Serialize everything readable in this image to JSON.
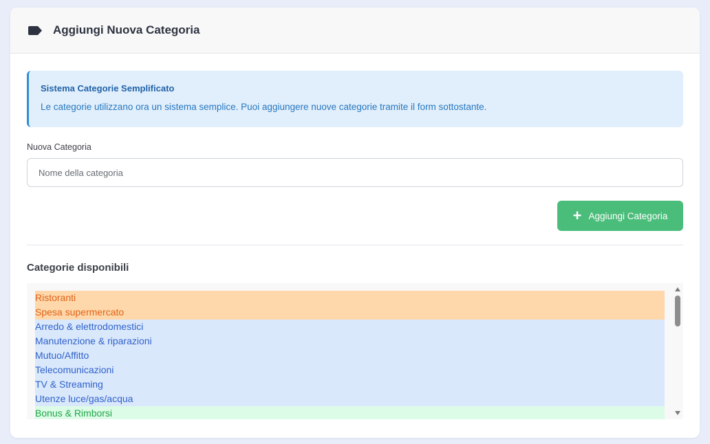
{
  "header": {
    "title": "Aggiungi Nuova Categoria",
    "icon": "tag-icon"
  },
  "info": {
    "title": "Sistema Categorie Semplificato",
    "text": "Le categorie utilizzano ora un sistema semplice. Puoi aggiungere nuove categorie tramite il form sottostante."
  },
  "form": {
    "label": "Nuova Categoria",
    "placeholder": "Nome della categoria",
    "value": "",
    "button_label": "Aggiungi Categoria",
    "button_color": "#4bbd7a"
  },
  "list": {
    "title": "Categorie disponibili",
    "items": [
      {
        "label": "Ristoranti",
        "group": "orange"
      },
      {
        "label": "Spesa supermercato",
        "group": "orange"
      },
      {
        "label": "Arredo & elettrodomestici",
        "group": "blue"
      },
      {
        "label": "Manutenzione & riparazioni",
        "group": "blue"
      },
      {
        "label": "Mutuo/Affitto",
        "group": "blue"
      },
      {
        "label": "Telecomunicazioni",
        "group": "blue"
      },
      {
        "label": "TV & Streaming",
        "group": "blue"
      },
      {
        "label": "Utenze luce/gas/acqua",
        "group": "blue"
      },
      {
        "label": "Bonus & Rimborsi",
        "group": "green"
      }
    ],
    "colors": {
      "orange": "#fed8aa",
      "blue": "#dae8fc",
      "green": "#dcfce7"
    }
  }
}
